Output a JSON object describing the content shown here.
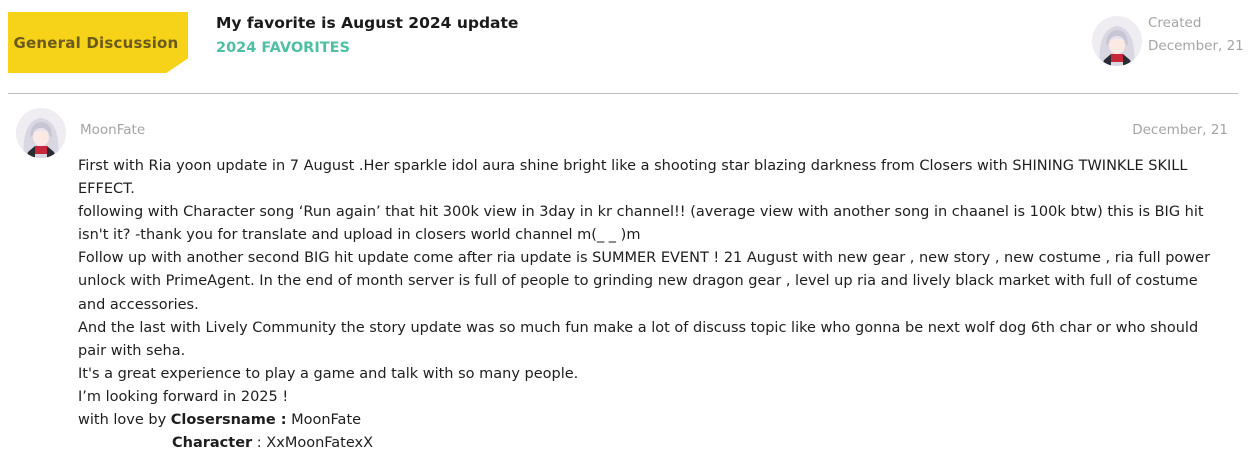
{
  "thread": {
    "category": "General Discussion",
    "title": "My favorite is August 2024 update",
    "subforum": "2024 FAVORITES",
    "created_label": "Created",
    "created_date": "December, 21"
  },
  "post": {
    "author": "MoonFate",
    "date": "December, 21",
    "paragraphs": [
      "First with Ria yoon update in 7 August .Her sparkle idol aura shine bright like a shooting star blazing darkness from Closers with SHINING TWINKLE SKILL EFFECT.",
      "following with Character song ‘Run again’ that hit 300k view in 3day in kr channel!! (average view with another song in chaanel is 100k btw) this is BIG hit isn't it? -thank you for translate and upload in closers world channel m(_ _ )m",
      "Follow up with another second BIG hit update come after ria update is SUMMER EVENT ! 21 August with new gear , new story , new costume , ria full power unlock with PrimeAgent. In the end of month server is full of people to grinding new dragon gear , level up ria and lively black market with full of costume and accessories.",
      "And the last with Lively Community the story update was so much fun make a lot of discuss topic like who gonna be next wolf dog 6th char or who should pair with seha.",
      "It's a great experience to play a game and talk with so many people.",
      "I’m looking forward in 2025 !"
    ],
    "signature": {
      "prefix": "with love by ",
      "name_label": "Closersname :",
      "name_value": " MoonFate",
      "char_label": "Character",
      "char_value": " : XxMoonFatexX"
    }
  },
  "colors": {
    "category_bg": "#f6d318",
    "category_text": "#6b5b1a",
    "subforum": "#4fbfa3",
    "meta": "#a4a4a4",
    "divider": "#bdbdbd"
  }
}
